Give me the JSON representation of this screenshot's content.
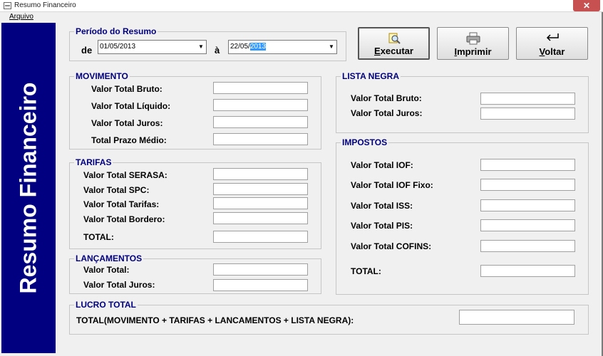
{
  "window": {
    "title": "Resumo Financeiro",
    "close_glyph": "✕"
  },
  "menu": {
    "arquivo": "Arquivo"
  },
  "banner": {
    "text": "Resumo Financeiro"
  },
  "periodo": {
    "title": "Período do Resumo",
    "de_label": "de",
    "a_label": "à",
    "start_date": "01/05/2013",
    "end_date_prefix": "22/05/",
    "end_date_selected": "2013"
  },
  "buttons": {
    "executar": {
      "label": "Executar",
      "icon": "magnifier-document-icon"
    },
    "imprimir": {
      "label": "Imprimir",
      "icon": "printer-icon"
    },
    "voltar": {
      "label": "Voltar",
      "icon": "return-arrow-icon"
    }
  },
  "movimento": {
    "title": "MOVIMENTO",
    "labels": [
      "Valor Total Bruto:",
      "Valor Total Líquido:",
      "Valor Total Juros:",
      "Total Prazo Médio:"
    ]
  },
  "tarifas": {
    "title": "TARIFAS",
    "labels": [
      "Valor Total SERASA:",
      "Valor Total SPC:",
      "Valor Total Tarifas:",
      "Valor Total Bordero:",
      "TOTAL:"
    ]
  },
  "lancamentos": {
    "title": "LANÇAMENTOS",
    "labels": [
      "Valor Total:",
      "Valor Total Juros:"
    ]
  },
  "lista_negra": {
    "title": "LISTA NEGRA",
    "labels": [
      "Valor Total Bruto:",
      "Valor Total Juros:"
    ]
  },
  "impostos": {
    "title": "IMPOSTOS",
    "labels": [
      "Valor Total IOF:",
      "Valor Total IOF Fixo:",
      "Valor Total ISS:",
      "Valor Total PIS:",
      "Valor Total COFINS:",
      "TOTAL:"
    ]
  },
  "lucro": {
    "title": "LUCRO TOTAL",
    "label": "TOTAL(MOVIMENTO + TARIFAS + LANCAMENTOS + LISTA NEGRA):"
  },
  "colors": {
    "banner": "#000080",
    "group_title": "#000080",
    "selection": "#3399ff"
  }
}
